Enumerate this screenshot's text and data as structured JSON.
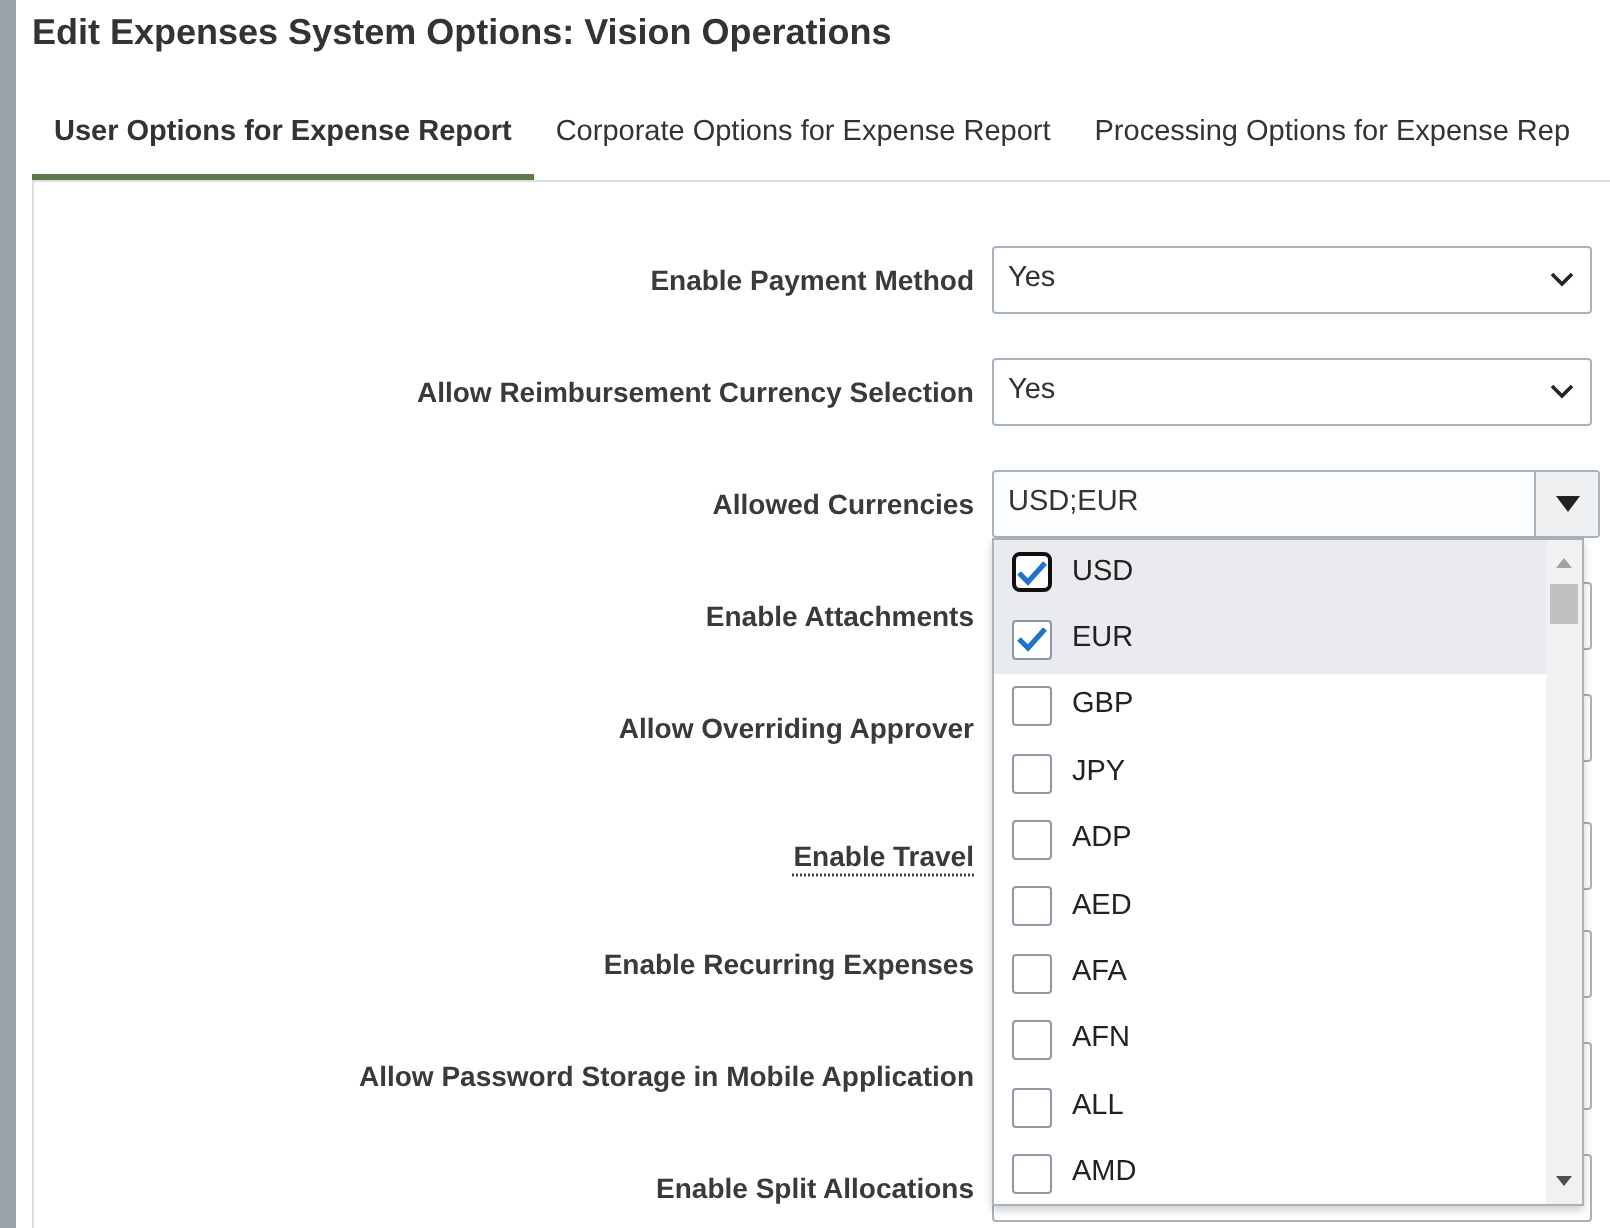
{
  "title": "Edit Expenses System Options: Vision Operations",
  "tabs": [
    {
      "label": "User Options for Expense Report",
      "selected": true
    },
    {
      "label": "Corporate Options for Expense Report",
      "selected": false
    },
    {
      "label": "Processing Options for Expense Rep",
      "selected": false
    }
  ],
  "fields": [
    {
      "label": "Enable Payment Method",
      "kind": "select",
      "value": "Yes",
      "has_help": false
    },
    {
      "label": "Allow Reimbursement Currency Selection",
      "kind": "select",
      "value": "Yes",
      "has_help": false
    },
    {
      "label": "Allowed Currencies",
      "kind": "multi",
      "value": "USD;EUR",
      "has_help": false,
      "options": [
        {
          "label": "USD",
          "checked": true,
          "focused": true
        },
        {
          "label": "EUR",
          "checked": true,
          "focused": false
        },
        {
          "label": "GBP",
          "checked": false,
          "focused": false
        },
        {
          "label": "JPY",
          "checked": false,
          "focused": false
        },
        {
          "label": "ADP",
          "checked": false,
          "focused": false
        },
        {
          "label": "AED",
          "checked": false,
          "focused": false
        },
        {
          "label": "AFA",
          "checked": false,
          "focused": false
        },
        {
          "label": "AFN",
          "checked": false,
          "focused": false
        },
        {
          "label": "ALL",
          "checked": false,
          "focused": false
        },
        {
          "label": "AMD",
          "checked": false,
          "focused": false
        }
      ]
    },
    {
      "label": "Enable Attachments",
      "kind": "select",
      "has_help": false
    },
    {
      "label": "Allow Overriding Approver",
      "kind": "select",
      "has_help": false
    },
    {
      "label": "Enable Travel",
      "kind": "select",
      "has_help": true
    },
    {
      "label": "Enable Recurring Expenses",
      "kind": "select",
      "has_help": false
    },
    {
      "label": "Allow Password Storage in Mobile Application",
      "kind": "select",
      "has_help": false
    },
    {
      "label": "Enable Split Allocations",
      "kind": "select",
      "has_help": false
    }
  ]
}
